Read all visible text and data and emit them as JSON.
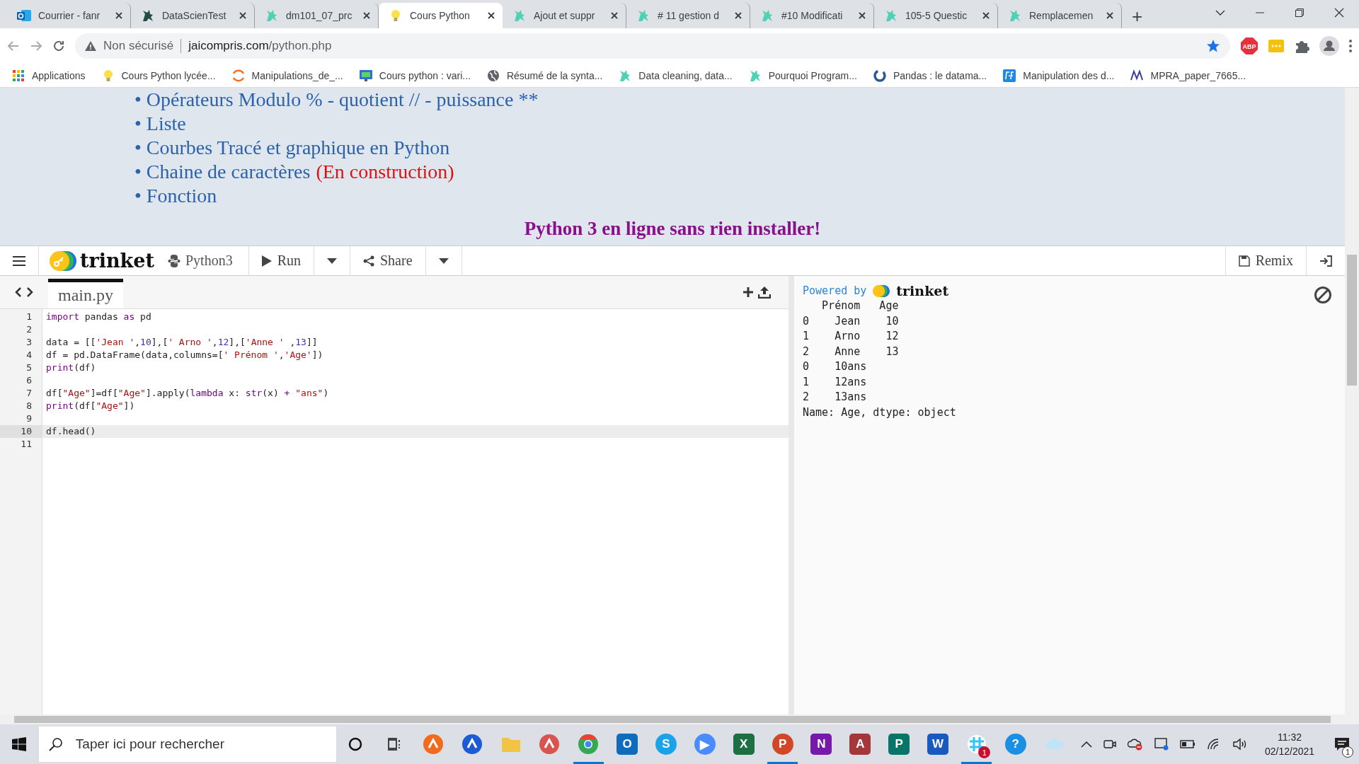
{
  "browser": {
    "tabs": [
      {
        "title": "Courrier - fanr",
        "kind": "outlook",
        "selected": false
      },
      {
        "title": "DataScienTest",
        "kind": "dragon-dark",
        "selected": false
      },
      {
        "title": "dm101_07_prc",
        "kind": "dragon",
        "selected": false
      },
      {
        "title": "Cours Python",
        "kind": "bulb",
        "selected": true
      },
      {
        "title": "Ajout et suppr",
        "kind": "dragon",
        "selected": false
      },
      {
        "title": "# 11 gestion d",
        "kind": "dragon",
        "selected": false
      },
      {
        "title": "#10 Modificati",
        "kind": "dragon",
        "selected": false
      },
      {
        "title": "105-5 Questic",
        "kind": "dragon",
        "selected": false
      },
      {
        "title": "Remplacemen",
        "kind": "dragon",
        "selected": false
      }
    ],
    "new_tab": "+",
    "address": {
      "security": "Non sécurisé",
      "host": "jaicompris.com",
      "path": "/python.php"
    },
    "extensions": [
      {
        "kind": "abp",
        "label": "ABP"
      },
      {
        "kind": "dots"
      },
      {
        "kind": "puzzle"
      },
      {
        "kind": "profile"
      }
    ],
    "bookmarks": [
      {
        "label": "Applications",
        "kind": "apps"
      },
      {
        "label": "Cours Python lycée...",
        "kind": "bulb"
      },
      {
        "label": "Manipulations_de_...",
        "kind": "arc"
      },
      {
        "label": "Cours python : vari...",
        "kind": "monitor"
      },
      {
        "label": "Résumé de la synta...",
        "kind": "globe"
      },
      {
        "label": "Data cleaning, data...",
        "kind": "dragon"
      },
      {
        "label": "Pourquoi Program...",
        "kind": "dragon"
      },
      {
        "label": "Pandas : le datama...",
        "kind": "ring"
      },
      {
        "label": "Manipulation des d...",
        "kind": "pf"
      },
      {
        "label": "MPRA_paper_7665...",
        "kind": "m"
      }
    ]
  },
  "page": {
    "menu": [
      {
        "text": "• Opérateurs Modulo % - quotient // - puissance **"
      },
      {
        "text": "• Liste"
      },
      {
        "text": "• Courbes Tracé et graphique en Python"
      },
      {
        "text": "• Chaine de caractères",
        "note": "(En construction)"
      },
      {
        "text": "• Fonction"
      }
    ],
    "heading": "Python 3 en ligne sans rien installer!"
  },
  "trinket": {
    "logo": "trinket",
    "language": "Python3",
    "run": "Run",
    "share": "Share",
    "remix": "Remix",
    "file_tab": {
      "label": "main.py",
      "selected": true
    },
    "code": [
      {
        "number": "1",
        "current": false,
        "tokens": [
          {
            "kind": "keyword",
            "text": "import"
          },
          {
            "kind": "plain",
            "text": " pandas "
          },
          {
            "kind": "keyword",
            "text": "as"
          },
          {
            "kind": "plain",
            "text": " pd"
          }
        ]
      },
      {
        "number": "2",
        "current": false
      },
      {
        "number": "3",
        "current": false,
        "tokens": [
          {
            "kind": "plain",
            "text": "data = [["
          },
          {
            "kind": "string",
            "text": "'Jean '"
          },
          {
            "kind": "plain",
            "text": ","
          },
          {
            "kind": "number",
            "text": "10"
          },
          {
            "kind": "plain",
            "text": "],["
          },
          {
            "kind": "string",
            "text": "' Arno '"
          },
          {
            "kind": "plain",
            "text": ","
          },
          {
            "kind": "number",
            "text": "12"
          },
          {
            "kind": "plain",
            "text": "],["
          },
          {
            "kind": "string",
            "text": "'Anne '"
          },
          {
            "kind": "plain",
            "text": " ,"
          },
          {
            "kind": "number",
            "text": "13"
          },
          {
            "kind": "plain",
            "text": "]]"
          }
        ]
      },
      {
        "number": "4",
        "current": false,
        "tokens": [
          {
            "kind": "plain",
            "text": "df = pd.DataFrame(data,columns=["
          },
          {
            "kind": "string",
            "text": "' Prénom '"
          },
          {
            "kind": "plain",
            "text": ","
          },
          {
            "kind": "string",
            "text": "'Age'"
          },
          {
            "kind": "plain",
            "text": "])"
          }
        ]
      },
      {
        "number": "5",
        "current": false,
        "tokens": [
          {
            "kind": "keyword",
            "text": "print"
          },
          {
            "kind": "plain",
            "text": "(df)"
          }
        ]
      },
      {
        "number": "6",
        "current": false
      },
      {
        "number": "7",
        "current": false,
        "tokens": [
          {
            "kind": "plain",
            "text": "df["
          },
          {
            "kind": "string",
            "text": "\"Age\""
          },
          {
            "kind": "plain",
            "text": "]=df["
          },
          {
            "kind": "string",
            "text": "\"Age\""
          },
          {
            "kind": "plain",
            "text": "].apply("
          },
          {
            "kind": "keyword",
            "text": "lambda"
          },
          {
            "kind": "plain",
            "text": " x: "
          },
          {
            "kind": "keyword",
            "text": "str"
          },
          {
            "kind": "plain",
            "text": "(x) "
          },
          {
            "kind": "keyword",
            "text": "+ "
          },
          {
            "kind": "string",
            "text": "\"ans\""
          },
          {
            "kind": "plain",
            "text": ")"
          }
        ]
      },
      {
        "number": "8",
        "current": false,
        "tokens": [
          {
            "kind": "keyword",
            "text": "print"
          },
          {
            "kind": "plain",
            "text": "(df["
          },
          {
            "kind": "string",
            "text": "\"Age\""
          },
          {
            "kind": "plain",
            "text": "])"
          }
        ]
      },
      {
        "number": "9",
        "current": false
      },
      {
        "number": "10",
        "current": true,
        "tokens": [
          {
            "kind": "plain",
            "text": "df.head()"
          }
        ]
      },
      {
        "number": "11",
        "current": false
      }
    ],
    "powered_by": "Powered by",
    "powered_logo": "trinket",
    "output": [
      "   Prénom   Age",
      "0    Jean    10",
      "1    Arno    12",
      "2    Anne    13",
      "0    10ans",
      "1    12ans",
      "2    13ans",
      "Name: Age, dtype: object"
    ]
  },
  "taskbar": {
    "search": {
      "placeholder": "Taper ici pour rechercher"
    },
    "apps": [
      {
        "kind": "cortana",
        "running": false
      },
      {
        "kind": "taskview",
        "running": false
      },
      {
        "kind": "avast",
        "running": false,
        "color": "#f26b1d"
      },
      {
        "kind": "malwarebytes",
        "running": false,
        "color": "#1d5bd6"
      },
      {
        "kind": "folder",
        "running": false,
        "color": "#f3c344"
      },
      {
        "kind": "snip",
        "running": false,
        "color": "#d9534f"
      },
      {
        "kind": "chrome",
        "running": true
      },
      {
        "kind": "tile",
        "letter": "O",
        "running": false,
        "color": "#0f6cbd"
      },
      {
        "kind": "round",
        "letter": "S",
        "running": false,
        "color": "#1aa3e8"
      },
      {
        "kind": "round",
        "letter": "▶",
        "running": false,
        "color": "#4a8cff"
      },
      {
        "kind": "tile",
        "letter": "X",
        "running": false,
        "color": "#1d7044"
      },
      {
        "kind": "round",
        "letter": "P",
        "running": true,
        "color": "#d24726"
      },
      {
        "kind": "tile",
        "letter": "N",
        "running": false,
        "color": "#7719aa"
      },
      {
        "kind": "tile",
        "letter": "A",
        "running": false,
        "color": "#a4373a"
      },
      {
        "kind": "tile",
        "letter": "P",
        "running": false,
        "color": "#077568"
      },
      {
        "kind": "tile",
        "letter": "W",
        "running": false,
        "color": "#185abd"
      },
      {
        "kind": "slack",
        "badge": "1",
        "running": true
      },
      {
        "kind": "help",
        "letter": "?",
        "running": false,
        "color": "#1a8fe3"
      },
      {
        "kind": "cloud",
        "running": false
      }
    ],
    "time": "11:32",
    "date": "02/12/2021",
    "notifications": "1"
  }
}
